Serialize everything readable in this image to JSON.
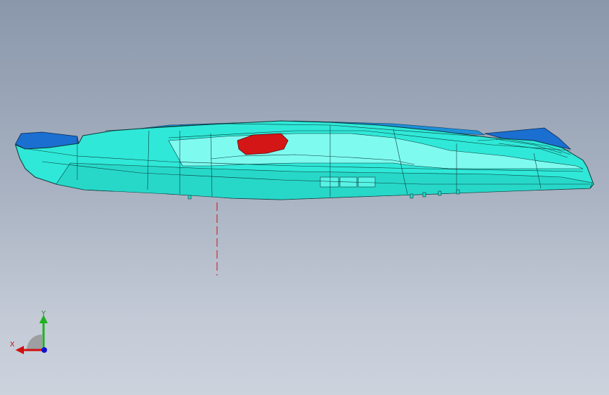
{
  "viewport": {
    "background_top": "#8a97ab",
    "background_bottom": "#cdd3dd"
  },
  "model": {
    "body_color": "#2fe8d8",
    "highlight_color": "#8ffff6",
    "edge_color": "#0a3a38",
    "dark_part_color": "#1a6fd0",
    "red_part_color": "#d41616",
    "centerline_color": "#cc1111"
  },
  "triad": {
    "x_label": "X",
    "y_label": "Y",
    "x_color": "#d01010",
    "y_color": "#20b020",
    "z_color": "#1010d0"
  }
}
